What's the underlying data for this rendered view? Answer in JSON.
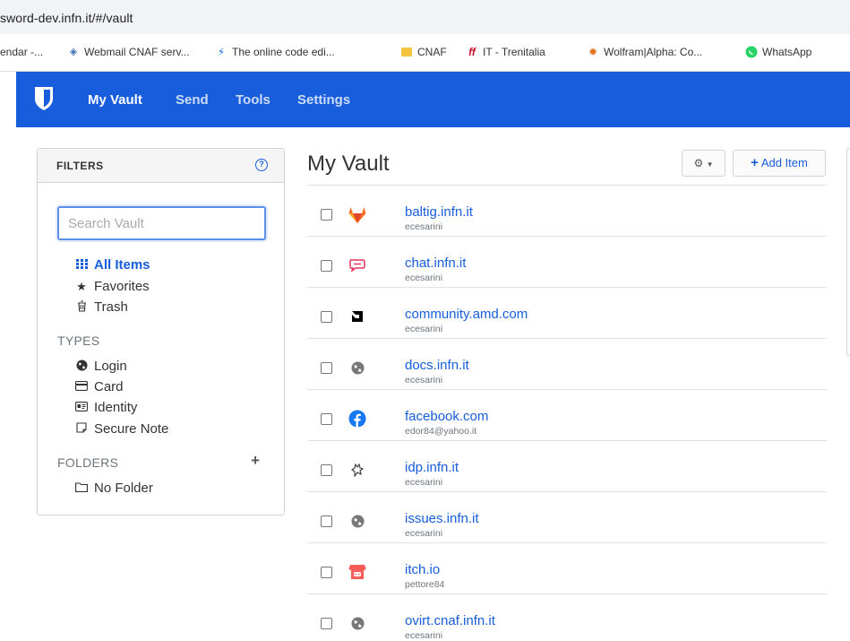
{
  "browser": {
    "url": "sword-dev.infn.it/#/vault",
    "bookmarks": [
      {
        "label": "endar -...",
        "icon": "calendar-icon"
      },
      {
        "label": "Webmail CNAF serv...",
        "icon": "webmail-icon"
      },
      {
        "label": "The online code edi...",
        "icon": "lightning-icon"
      },
      {
        "label": "CNAF",
        "icon": "folder-icon"
      },
      {
        "label": "IT - Trenitalia",
        "icon": "trenitalia-icon"
      },
      {
        "label": "Wolfram|Alpha: Co...",
        "icon": "wolfram-icon"
      },
      {
        "label": "WhatsApp",
        "icon": "whatsapp-icon"
      }
    ]
  },
  "nav": {
    "items": [
      "My Vault",
      "Send",
      "Tools",
      "Settings"
    ],
    "brand_color": "#175ddc"
  },
  "filters": {
    "title": "FILTERS",
    "search_placeholder": "Search Vault",
    "all_items": "All Items",
    "favorites": "Favorites",
    "trash": "Trash",
    "types_label": "TYPES",
    "types": [
      "Login",
      "Card",
      "Identity",
      "Secure Note"
    ],
    "folders_label": "FOLDERS",
    "no_folder": "No Folder"
  },
  "main": {
    "title": "My Vault",
    "add_item": "Add Item",
    "items": [
      {
        "name": "baltig.infn.it",
        "user": "ecesarini",
        "icon": "gitlab-icon"
      },
      {
        "name": "chat.infn.it",
        "user": "ecesarini",
        "icon": "chat-icon"
      },
      {
        "name": "community.amd.com",
        "user": "ecesarini",
        "icon": "amd-icon"
      },
      {
        "name": "docs.infn.it",
        "user": "ecesarini",
        "icon": "globe-icon"
      },
      {
        "name": "facebook.com",
        "user": "edor84@yahoo.it",
        "icon": "facebook-icon"
      },
      {
        "name": "idp.infn.it",
        "user": "ecesarini",
        "icon": "idp-icon"
      },
      {
        "name": "issues.infn.it",
        "user": "ecesarini",
        "icon": "globe-icon"
      },
      {
        "name": "itch.io",
        "user": "pettore84",
        "icon": "itch-icon"
      },
      {
        "name": "ovirt.cnaf.infn.it",
        "user": "ecesarini",
        "icon": "globe-icon"
      }
    ]
  }
}
